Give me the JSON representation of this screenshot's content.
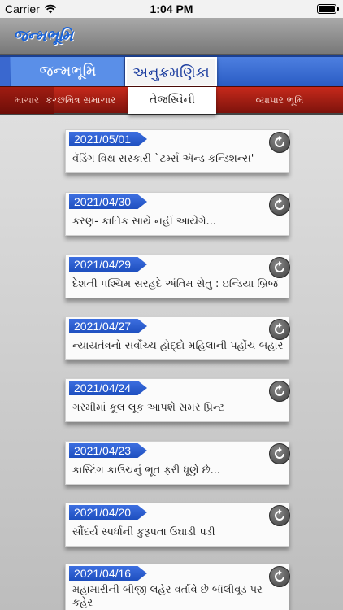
{
  "status_bar": {
    "carrier": "Carrier",
    "time": "1:04 PM"
  },
  "header": {
    "logo_text": "જન્મભૂમિ"
  },
  "tabs_primary": [
    {
      "label": ""
    },
    {
      "label": "જન્મભૂમિ"
    },
    {
      "label": "અનુક્રમણિકા",
      "selected": true
    }
  ],
  "tabs_secondary": [
    {
      "label": "માચાર"
    },
    {
      "label": "કચ્છમિત્ર સમાચાર"
    },
    {
      "label": "તેજસ્વિની",
      "selected": true
    },
    {
      "label": "વ્યાપાર ભૂમિ"
    }
  ],
  "articles": [
    {
      "date": "2021/05/01",
      "title": "વૅડિંગ વિથ સરકારી `ટર્મ્સ ઍન્ડ કન્ડિશન્સ'"
    },
    {
      "date": "2021/04/30",
      "title": "કરણ- કાર્તિક સાથે નહીં આયેંગે..."
    },
    {
      "date": "2021/04/29",
      "title": "દેશની પશ્ચિમ સરહદે અંતિમ સેતુ : ઇન્ડિયા બ્રિજ"
    },
    {
      "date": "2021/04/27",
      "title": "ન્યાયતંત્રનો સર્વોચ્ચ હોદ્દો મહિલાની પહોંચ બહાર!"
    },
    {
      "date": "2021/04/24",
      "title": "ગરમીમાં કૂલ લૂક આપશે સમર પ્રિન્ટ"
    },
    {
      "date": "2021/04/23",
      "title": "કાસ્ટિંગ કાઉચનું ભૂત ફરી ધૂણે છે..."
    },
    {
      "date": "2021/04/20",
      "title": "સૌંદર્ય સ્પર્ધાની કુરૂપતા ઉઘાડી પડી"
    },
    {
      "date": "2021/04/16",
      "title": "મહામારીની બીજી લહેર વર્તાવે છે બૉલીવૂડ પર કહેર"
    }
  ]
}
